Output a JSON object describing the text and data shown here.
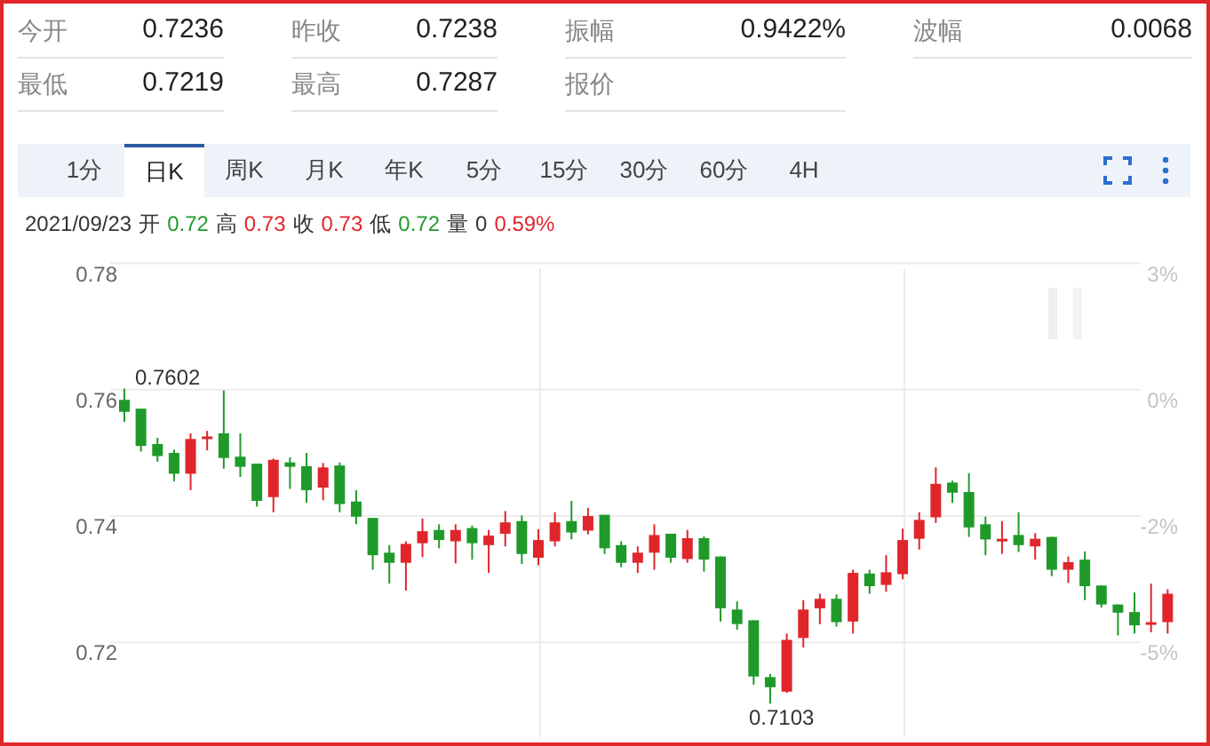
{
  "quote": {
    "rows": [
      [
        {
          "label": "今开",
          "value": "0.7236"
        },
        {
          "label": "昨收",
          "value": "0.7238"
        },
        {
          "label": "振幅",
          "value": "0.9422%"
        },
        {
          "label": "波幅",
          "value": "0.0068"
        }
      ],
      [
        {
          "label": "最低",
          "value": "0.7219"
        },
        {
          "label": "最高",
          "value": "0.7287"
        },
        {
          "label": "报价"
        }
      ]
    ]
  },
  "tabs": [
    {
      "label": "1分",
      "selected": false
    },
    {
      "label": "日K",
      "selected": true
    },
    {
      "label": "周K",
      "selected": false
    },
    {
      "label": "月K",
      "selected": false
    },
    {
      "label": "年K",
      "selected": false
    },
    {
      "label": "5分",
      "selected": false
    },
    {
      "label": "15分",
      "selected": false
    },
    {
      "label": "30分",
      "selected": false
    },
    {
      "label": "60分",
      "selected": false
    },
    {
      "label": "4H",
      "selected": false
    }
  ],
  "summary": {
    "date": "2021/09/23",
    "items": [
      {
        "label": "开",
        "value": "0.72",
        "color": "#1f9a2a"
      },
      {
        "label": "高",
        "value": "0.73",
        "color": "#e0262b"
      },
      {
        "label": "收",
        "value": "0.73",
        "color": "#e0262b"
      },
      {
        "label": "低",
        "value": "0.72",
        "color": "#1f9a2a"
      },
      {
        "label": "量",
        "value": "0",
        "color": "#333333"
      },
      {
        "value": "0.59%",
        "color": "#e0262b"
      }
    ]
  },
  "chart": {
    "right_axis_labels": [
      "3%",
      "0%",
      "-2%",
      "-5%"
    ],
    "price_annotations": [
      "0.7602",
      "0.7103"
    ],
    "chart_data": {
      "type": "candlestick",
      "grid": true,
      "ylim": [
        0.705,
        0.78
      ],
      "yticks": [
        {
          "value": 0.78,
          "label": "0.78"
        },
        {
          "value": 0.76,
          "label": "0.76"
        },
        {
          "value": 0.74,
          "label": "0.74"
        },
        {
          "value": 0.72,
          "label": "0.72"
        }
      ],
      "ohlc": [
        [
          0.7584,
          0.7602,
          0.7549,
          0.7565
        ],
        [
          0.757,
          0.757,
          0.7502,
          0.7511
        ],
        [
          0.7514,
          0.7524,
          0.7486,
          0.7495
        ],
        [
          0.75,
          0.7505,
          0.7455,
          0.7467
        ],
        [
          0.7467,
          0.7531,
          0.7441,
          0.7522
        ],
        [
          0.7524,
          0.7535,
          0.7504,
          0.7526
        ],
        [
          0.7531,
          0.7599,
          0.7475,
          0.7492
        ],
        [
          0.7494,
          0.7531,
          0.7462,
          0.7478
        ],
        [
          0.7483,
          0.7483,
          0.7415,
          0.7424
        ],
        [
          0.743,
          0.7491,
          0.7406,
          0.7489
        ],
        [
          0.7485,
          0.7493,
          0.7443,
          0.7478
        ],
        [
          0.7479,
          0.75,
          0.7421,
          0.7441
        ],
        [
          0.7445,
          0.7484,
          0.7425,
          0.7477
        ],
        [
          0.748,
          0.7485,
          0.7406,
          0.7419
        ],
        [
          0.7423,
          0.7441,
          0.7387,
          0.7399
        ],
        [
          0.7397,
          0.7397,
          0.7315,
          0.7338
        ],
        [
          0.7342,
          0.7354,
          0.7293,
          0.7326
        ],
        [
          0.7326,
          0.736,
          0.7282,
          0.7356
        ],
        [
          0.7357,
          0.7396,
          0.7335,
          0.7376
        ],
        [
          0.7378,
          0.7387,
          0.7349,
          0.7362
        ],
        [
          0.736,
          0.7387,
          0.7325,
          0.7378
        ],
        [
          0.7381,
          0.7385,
          0.7331,
          0.7357
        ],
        [
          0.7354,
          0.7378,
          0.731,
          0.7369
        ],
        [
          0.7372,
          0.7408,
          0.7352,
          0.739
        ],
        [
          0.7392,
          0.7401,
          0.7324,
          0.734
        ],
        [
          0.7334,
          0.7379,
          0.7322,
          0.7362
        ],
        [
          0.736,
          0.7406,
          0.7352,
          0.739
        ],
        [
          0.7392,
          0.7424,
          0.7363,
          0.7374
        ],
        [
          0.7377,
          0.7413,
          0.7371,
          0.74
        ],
        [
          0.7402,
          0.7402,
          0.734,
          0.7349
        ],
        [
          0.7354,
          0.736,
          0.7319,
          0.7326
        ],
        [
          0.7326,
          0.7352,
          0.731,
          0.7342
        ],
        [
          0.7342,
          0.7387,
          0.7315,
          0.737
        ],
        [
          0.7372,
          0.7372,
          0.7326,
          0.7334
        ],
        [
          0.7332,
          0.7378,
          0.7326,
          0.7365
        ],
        [
          0.7365,
          0.7368,
          0.7312,
          0.7331
        ],
        [
          0.7336,
          0.7336,
          0.7233,
          0.7254
        ],
        [
          0.7252,
          0.7265,
          0.722,
          0.7229
        ],
        [
          0.7235,
          0.7235,
          0.7133,
          0.7146
        ],
        [
          0.7145,
          0.715,
          0.7103,
          0.7129
        ],
        [
          0.7122,
          0.7214,
          0.712,
          0.7204
        ],
        [
          0.7207,
          0.7267,
          0.7192,
          0.7252
        ],
        [
          0.7254,
          0.7277,
          0.7229,
          0.7269
        ],
        [
          0.7269,
          0.7276,
          0.7225,
          0.7232
        ],
        [
          0.7233,
          0.7315,
          0.7214,
          0.731
        ],
        [
          0.7309,
          0.7315,
          0.7277,
          0.7289
        ],
        [
          0.7291,
          0.7338,
          0.728,
          0.7311
        ],
        [
          0.7308,
          0.738,
          0.73,
          0.7362
        ],
        [
          0.7364,
          0.7406,
          0.7347,
          0.7394
        ],
        [
          0.7398,
          0.7477,
          0.7389,
          0.7451
        ],
        [
          0.7453,
          0.7456,
          0.7421,
          0.7437
        ],
        [
          0.7438,
          0.7468,
          0.7367,
          0.7382
        ],
        [
          0.7387,
          0.7399,
          0.7338,
          0.7363
        ],
        [
          0.7362,
          0.7392,
          0.734,
          0.7364
        ],
        [
          0.737,
          0.7406,
          0.7343,
          0.7354
        ],
        [
          0.7352,
          0.7373,
          0.7331,
          0.7364
        ],
        [
          0.7367,
          0.7367,
          0.7305,
          0.7315
        ],
        [
          0.7315,
          0.7336,
          0.7294,
          0.7327
        ],
        [
          0.7331,
          0.7344,
          0.7267,
          0.7289
        ],
        [
          0.729,
          0.729,
          0.7255,
          0.726
        ],
        [
          0.726,
          0.726,
          0.7211,
          0.7247
        ],
        [
          0.7248,
          0.7279,
          0.7214,
          0.7227
        ],
        [
          0.7229,
          0.7293,
          0.7216,
          0.7232
        ],
        [
          0.7232,
          0.7284,
          0.7214,
          0.7277
        ]
      ]
    }
  }
}
